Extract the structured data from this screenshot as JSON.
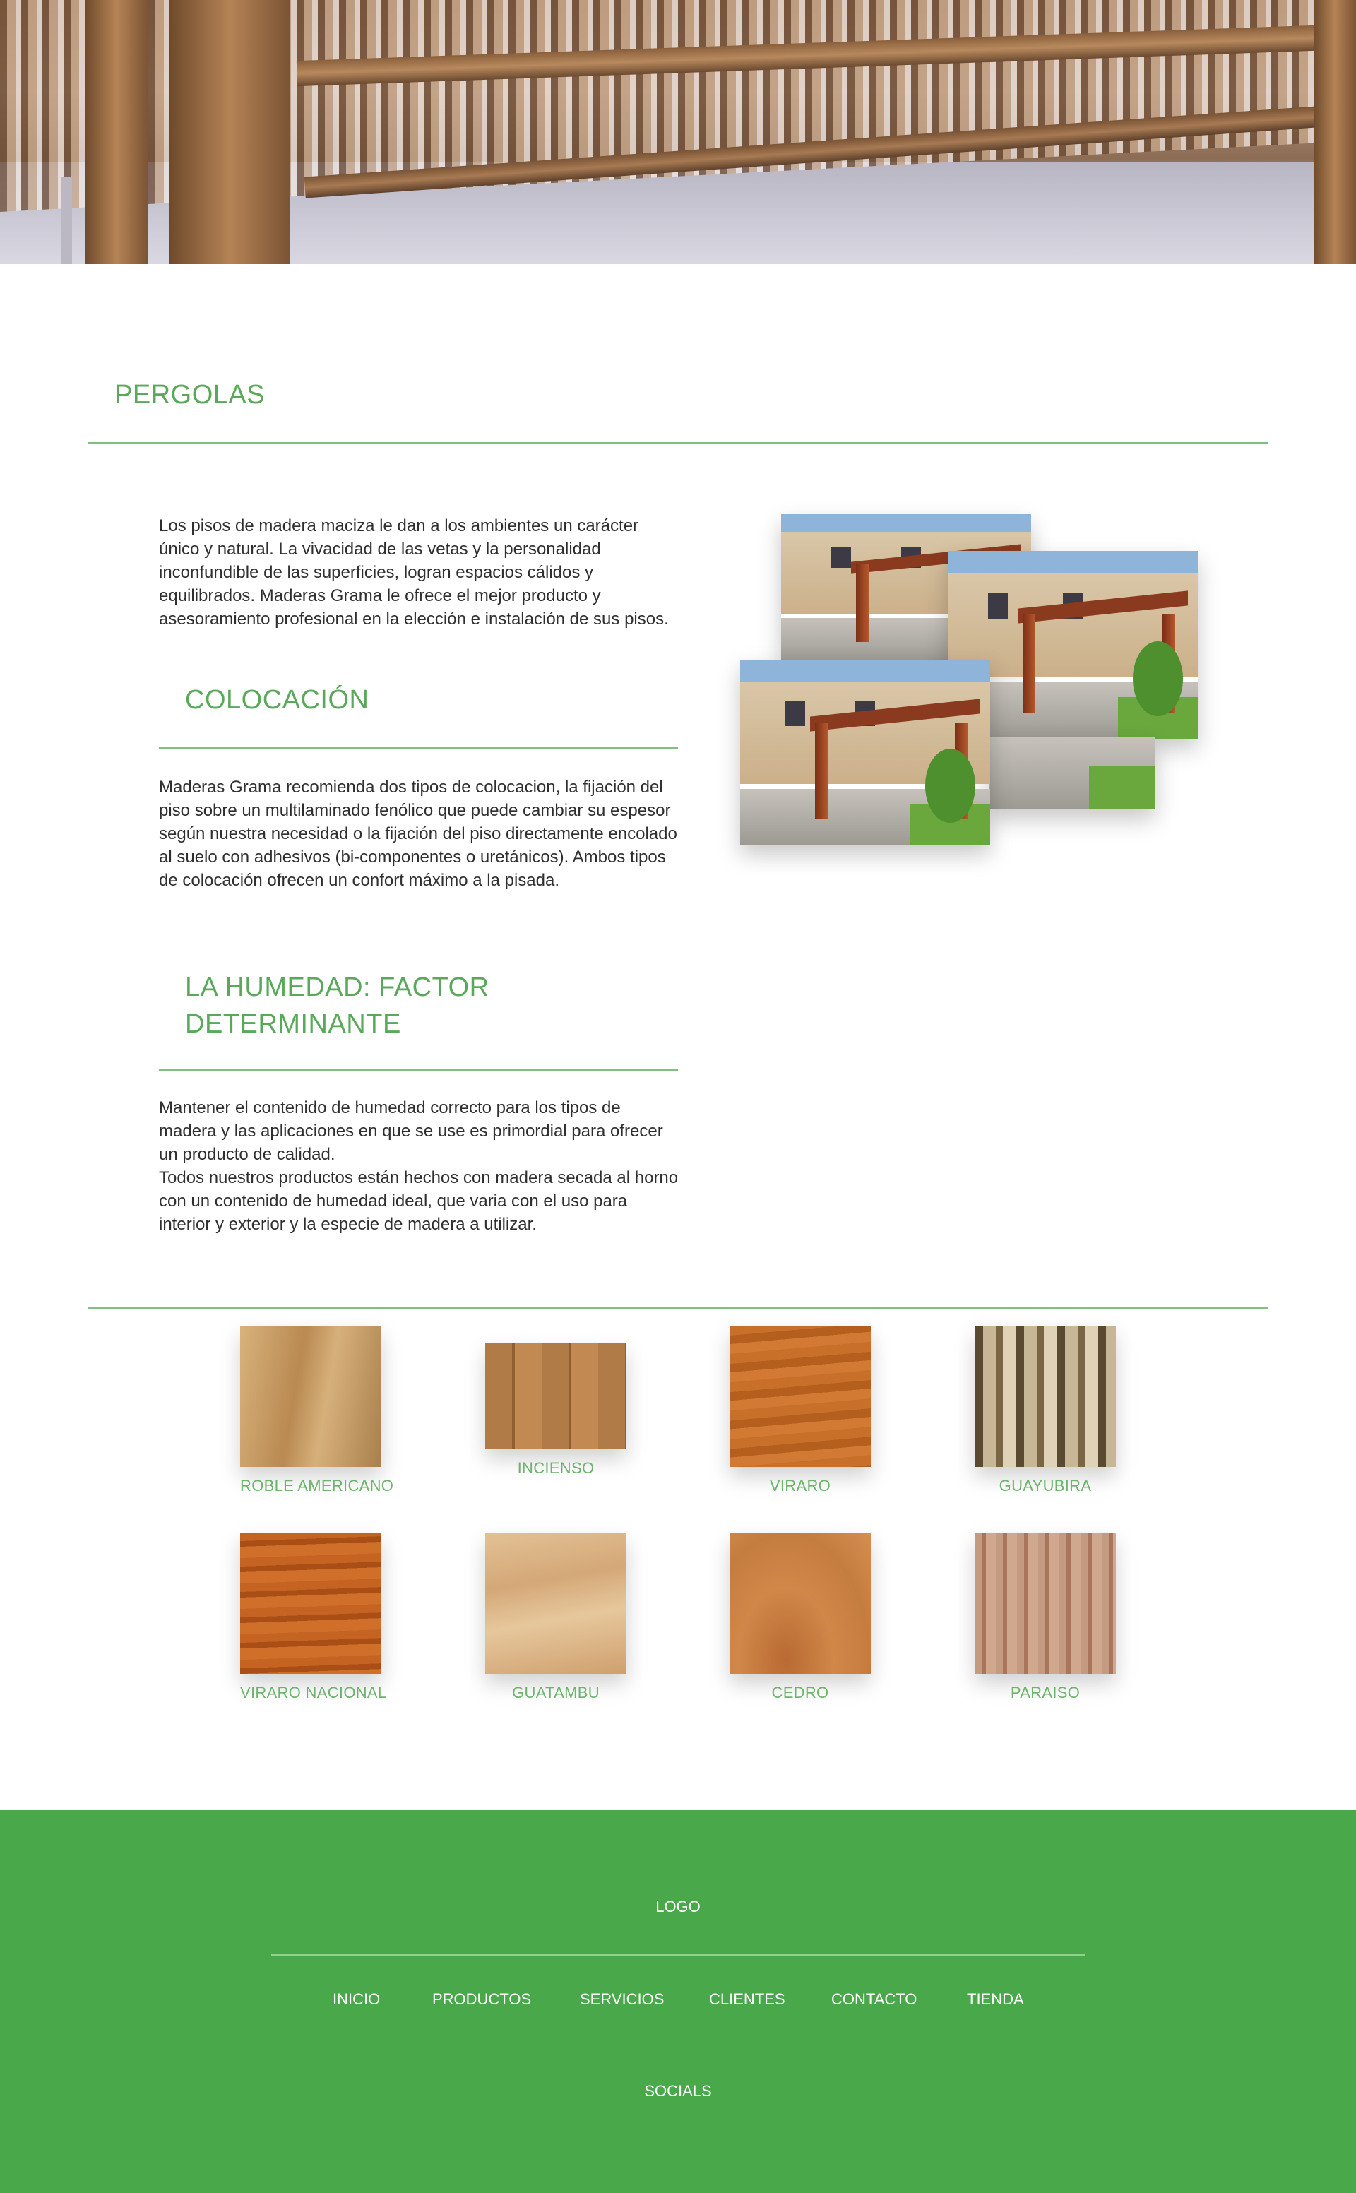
{
  "hero": {
    "image": "pergola-ceiling-photo"
  },
  "main": {
    "title": "PERGOLAS",
    "intro": "Los pisos de madera maciza le dan a los ambientes un carácter único y natural. La vivacidad de las vetas y la personalidad inconfundible de las superficies, logran espacios cálidos y equilibrados. Maderas Grama le ofrece el mejor producto y asesoramiento profesional en la elección e instalación de sus pisos.",
    "sections": [
      {
        "title": "COLOCACIÓN",
        "body": "Maderas Grama recomienda dos tipos de colocacion, la fijación del piso sobre un multilaminado fenólico que puede cambiar su espesor según nuestra necesidad o la fijación del piso directamente encolado al suelo con adhesivos (bi-componentes o uretánicos). Ambos tipos de colocación ofrecen un confort máximo a la pisada."
      },
      {
        "title_line1": "LA HUMEDAD: FACTOR",
        "title_line2": "DETERMINANTE",
        "body_line1": "Mantener el contenido de humedad correcto para los tipos de madera y las aplicaciones en que se use es primordial para ofrecer un producto de calidad.",
        "body_line2": "Todos nuestros productos están hechos con madera secada al horno con un contenido de humedad ideal, que varia con el uso para interior y exterior y la especie de madera a utilizar."
      }
    ]
  },
  "woods": [
    {
      "label": "ROBLE AMERICANO",
      "color": "#c9a06a"
    },
    {
      "label": "INCIENSO",
      "color": "#a9733f"
    },
    {
      "label": "VIRARO",
      "color": "#c26a22"
    },
    {
      "label": "GUAYUBIRA",
      "color": "#8c7a5a"
    },
    {
      "label": "VIRARO NACIONAL",
      "color": "#c05e1c"
    },
    {
      "label": "GUATAMBU",
      "color": "#d9b487"
    },
    {
      "label": "CEDRO",
      "color": "#c9783e"
    },
    {
      "label": "PARAISO",
      "color": "#b98a6e"
    }
  ],
  "footer": {
    "logo": "LOGO",
    "nav": [
      "INICIO",
      "PRODUCTOS",
      "SERVICIOS",
      "CLIENTES",
      "CONTACTO",
      "TIENDA"
    ],
    "socials": "SOCIALS",
    "background": "#48a84a"
  }
}
